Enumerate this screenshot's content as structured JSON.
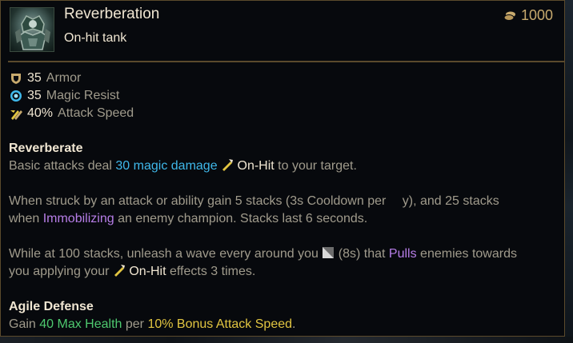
{
  "item": {
    "name": "Reverberation",
    "subtitle": "On-hit tank",
    "cost": "1000",
    "icon": "armored-champion-icon",
    "cost_icon": "gold-coins-icon"
  },
  "stats": [
    {
      "value": "35",
      "label": "Armor",
      "icon": "armor-shield-icon"
    },
    {
      "value": "35",
      "label": "Magic Resist",
      "icon": "magic-resist-icon"
    },
    {
      "value": "40%",
      "label": "Attack Speed",
      "icon": "attack-speed-icon"
    }
  ],
  "passives": {
    "reverberate": {
      "title": "Reverberate",
      "line1_a": "Basic attacks deal ",
      "line1_magic": "30 magic damage",
      "line1_onhit": "On-Hit",
      "line1_b": " to your target.",
      "p2_a": "When struck by an attack or ability gain 5 stacks (3s Cooldown per ",
      "p2_hidden": "cy",
      "p2_b": "y), and 25 stacks",
      "p2_c": "when ",
      "p2_immob": "Immobilizing",
      "p2_d": " an enemy champion. Stacks last 6 seconds.",
      "p3_a": "While at 100 stacks, unleash a wave every around you ",
      "p3_b": " (8s) that ",
      "p3_pulls": "Pulls",
      "p3_c": " enemies towards",
      "p3_d": "you applying your ",
      "p3_onhit": "On-Hit",
      "p3_e": " effects 3 times."
    },
    "agile": {
      "title": "Agile Defense",
      "a": "Gain ",
      "health": "40 Max Health",
      "b": " per ",
      "as": "10% Bonus Attack Speed",
      "c": "."
    }
  },
  "colors": {
    "border": "#5b4a2c",
    "gold": "#c8aa6e",
    "magic": "#3fb8ea",
    "purple": "#b77ee8",
    "health": "#4ec96f",
    "yellow": "#e2c541"
  }
}
